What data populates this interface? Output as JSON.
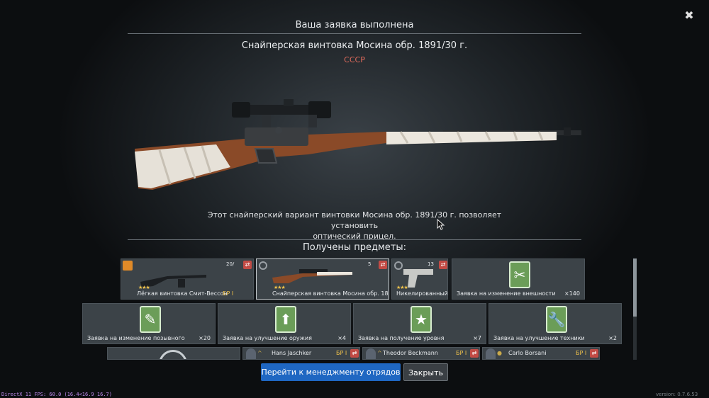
{
  "header": {
    "title": "Ваша заявка выполнена",
    "close_icon": "close-icon"
  },
  "item": {
    "name": "Снайперская винтовка Мосина обр. 1891/30 г.",
    "nation": "СССР",
    "description_line1": "Этот снайперский вариант винтовки Мосина обр. 1891/30 г. позволяет установить",
    "description_line2": "оптический прицел."
  },
  "received": {
    "title": "Получены предметы:",
    "row1": [
      {
        "label": "Лёгкая винтовка Смит-Вессон",
        "br": "БР I",
        "ammo": "20/",
        "stars": "★★★"
      },
      {
        "label": "Снайперская винтовка Мосина обр. 1891",
        "ammo": "5",
        "stars": "★★★"
      },
      {
        "label": "Никелированный Б",
        "ammo": "13",
        "stars": "★★★"
      },
      {
        "label": "Заявка на изменение внешности",
        "count": "×140",
        "icon": "scissors-icon"
      }
    ],
    "row2": [
      {
        "label": "Заявка на изменение позывного",
        "count": "×20",
        "icon": "pencil-icon"
      },
      {
        "label": "Заявка на улучшение оружия",
        "count": "×4",
        "icon": "arrow-up-icon"
      },
      {
        "label": "Заявка на получение уровня",
        "count": "×7",
        "icon": "star-icon"
      },
      {
        "label": "Заявка на улучшение техники",
        "count": "×2",
        "icon": "wrench-icon"
      }
    ],
    "soldiers": [
      {
        "name": "Hans Jaschker",
        "br": "БР I"
      },
      {
        "name": "Theodor Beckmann",
        "br": "БР I"
      },
      {
        "name": "Carlo Borsani",
        "br": "БР I"
      }
    ]
  },
  "buttons": {
    "manage_squads": "Перейти к менеджменту отрядов",
    "close": "Закрыть"
  },
  "footer": {
    "fps": "DirectX 11 FPS: 60.0 (16.4<16.9 16.7)",
    "version": "version: 0.7.6.53"
  },
  "colors": {
    "nation": "#e06b5c",
    "primary_button": "#1f67c2",
    "br_gold": "#f1c34b",
    "order_green": "#6b9d58"
  }
}
